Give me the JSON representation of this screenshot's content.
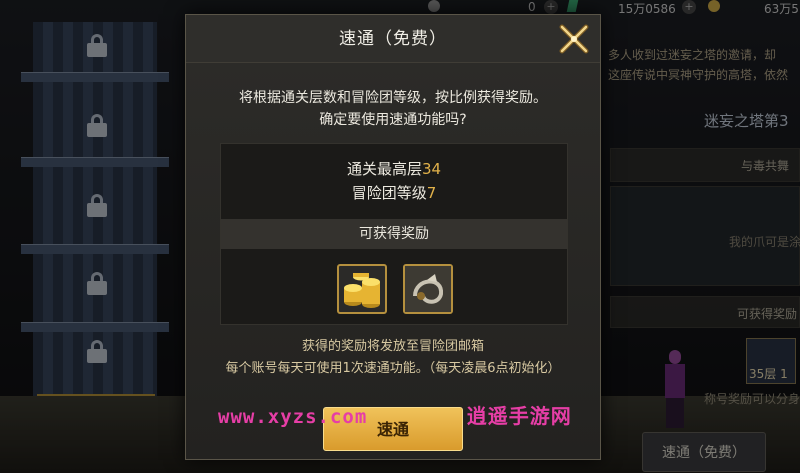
{
  "topbar": {
    "currency1": "0",
    "currency2": "15万0586",
    "currency3": "63万5"
  },
  "background": {
    "story_line1": "多人收到过迷妄之塔的邀请，却",
    "story_line2": "这座传说中冥神守护的高塔，依然",
    "tower_title": "迷妄之塔第3",
    "stage_name": "与毒共舞",
    "stage_quote": "我的爪可是涂",
    "rewards_label": "可获得奖励",
    "floor_badge": "35层 1",
    "reward_note": "称号奖励可以分身",
    "quick_pass_button": "速通（免费）"
  },
  "modal": {
    "title": "速通（免费）",
    "desc_line1": "将根据通关层数和冒险团等级，按比例获得奖励。",
    "desc_line2": "确定要使用速通功能吗?",
    "stat1_label": "通关最高层",
    "stat1_value": "34",
    "stat2_label": "冒险团等级",
    "stat2_value": "7",
    "rewards_header": "可获得奖励",
    "reward_items": [
      "gold-coins-icon",
      "accessory-icon"
    ],
    "note_line1": "获得的奖励将发放至冒险团邮箱",
    "note_line2": "每个账号每天可使用1次速通功能。（每天凌晨6点初始化）",
    "confirm_button": "速通"
  },
  "watermark": {
    "url": "www.xyzs.com",
    "name": "逍遥手游网"
  },
  "colors": {
    "accent_gold": "#e2b24a",
    "button_gold": "#f0c25a",
    "watermark_pink": "#e63ea6"
  }
}
